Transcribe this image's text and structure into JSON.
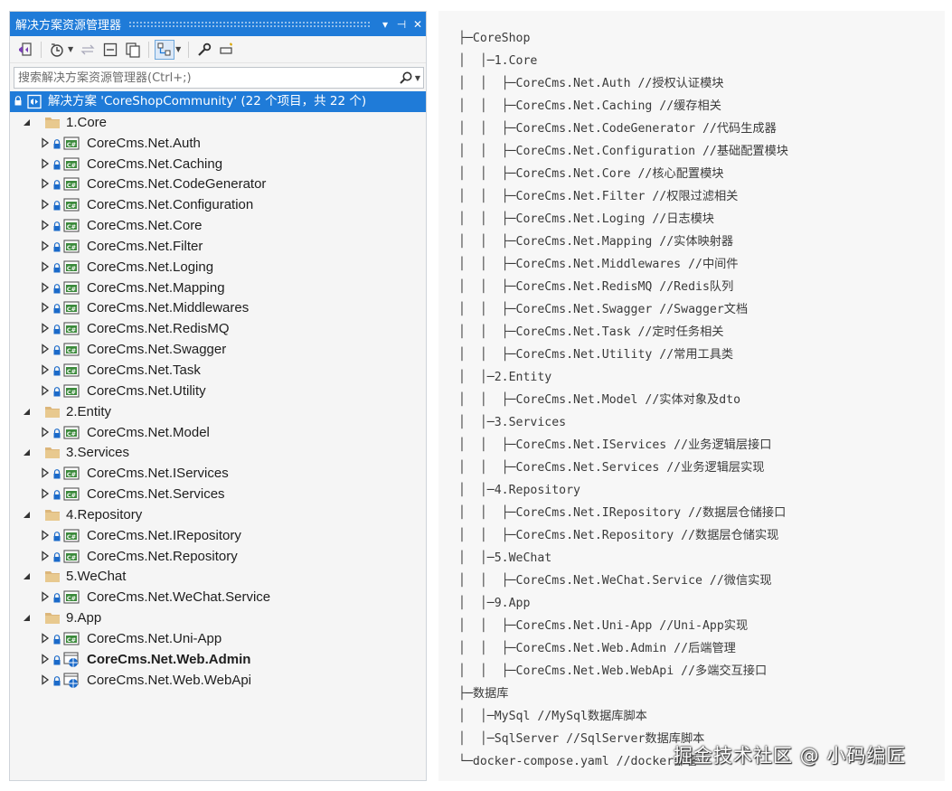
{
  "solution_explorer": {
    "title": "解决方案资源管理器",
    "controls": {
      "dropdown": "▾",
      "pin": "⊣",
      "close": "✕"
    },
    "search": {
      "placeholder": "搜索解决方案资源管理器(Ctrl+;)"
    },
    "colors": {
      "accent": "#1f7bd8",
      "folder": "#dcb67a",
      "project_icon": "#3c8a3c",
      "web_icon": "#1b6ac9"
    },
    "toolbar_icons": [
      "vs-switch-view-icon",
      "history-icon",
      "sync-icon",
      "collapse-all-icon",
      "show-all-files-icon",
      "git-changes-icon",
      "properties-wrench-icon",
      "preview-icon"
    ],
    "tree": [
      {
        "text": "解决方案 'CoreShopCommunity' (22 个项目，共 22 个)",
        "type": "solution",
        "level": 0,
        "selected": true
      },
      {
        "text": "1.Core",
        "type": "folder",
        "level": 1,
        "expanded": true
      },
      {
        "text": "CoreCms.Net.Auth",
        "type": "project",
        "level": 2
      },
      {
        "text": "CoreCms.Net.Caching",
        "type": "project",
        "level": 2
      },
      {
        "text": "CoreCms.Net.CodeGenerator",
        "type": "project",
        "level": 2
      },
      {
        "text": "CoreCms.Net.Configuration",
        "type": "project",
        "level": 2
      },
      {
        "text": "CoreCms.Net.Core",
        "type": "project",
        "level": 2
      },
      {
        "text": "CoreCms.Net.Filter",
        "type": "project",
        "level": 2
      },
      {
        "text": "CoreCms.Net.Loging",
        "type": "project",
        "level": 2
      },
      {
        "text": "CoreCms.Net.Mapping",
        "type": "project",
        "level": 2
      },
      {
        "text": "CoreCms.Net.Middlewares",
        "type": "project",
        "level": 2
      },
      {
        "text": "CoreCms.Net.RedisMQ",
        "type": "project",
        "level": 2
      },
      {
        "text": "CoreCms.Net.Swagger",
        "type": "project",
        "level": 2
      },
      {
        "text": "CoreCms.Net.Task",
        "type": "project",
        "level": 2
      },
      {
        "text": "CoreCms.Net.Utility",
        "type": "project",
        "level": 2
      },
      {
        "text": "2.Entity",
        "type": "folder",
        "level": 1,
        "expanded": true
      },
      {
        "text": "CoreCms.Net.Model",
        "type": "project",
        "level": 2
      },
      {
        "text": "3.Services",
        "type": "folder",
        "level": 1,
        "expanded": true
      },
      {
        "text": "CoreCms.Net.IServices",
        "type": "project",
        "level": 2
      },
      {
        "text": "CoreCms.Net.Services",
        "type": "project",
        "level": 2
      },
      {
        "text": "4.Repository",
        "type": "folder",
        "level": 1,
        "expanded": true
      },
      {
        "text": "CoreCms.Net.IRepository",
        "type": "project",
        "level": 2
      },
      {
        "text": "CoreCms.Net.Repository",
        "type": "project",
        "level": 2
      },
      {
        "text": "5.WeChat",
        "type": "folder",
        "level": 1,
        "expanded": true
      },
      {
        "text": "CoreCms.Net.WeChat.Service",
        "type": "project",
        "level": 2
      },
      {
        "text": "9.App",
        "type": "folder",
        "level": 1,
        "expanded": true
      },
      {
        "text": "CoreCms.Net.Uni-App",
        "type": "project",
        "level": 2
      },
      {
        "text": "CoreCms.Net.Web.Admin",
        "type": "web",
        "level": 2,
        "bold": true
      },
      {
        "text": "CoreCms.Net.Web.WebApi",
        "type": "web",
        "level": 2
      }
    ]
  },
  "directory_tree": [
    "├─CoreShop",
    "│  │─1.Core",
    "│  │  ├─CoreCms.Net.Auth //授权认证模块",
    "│  │  ├─CoreCms.Net.Caching //缓存相关",
    "│  │  ├─CoreCms.Net.CodeGenerator //代码生成器",
    "│  │  ├─CoreCms.Net.Configuration //基础配置模块",
    "│  │  ├─CoreCms.Net.Core //核心配置模块",
    "│  │  ├─CoreCms.Net.Filter //权限过滤相关",
    "│  │  ├─CoreCms.Net.Loging //日志模块",
    "│  │  ├─CoreCms.Net.Mapping //实体映射器",
    "│  │  ├─CoreCms.Net.Middlewares //中间件",
    "│  │  ├─CoreCms.Net.RedisMQ //Redis队列",
    "│  │  ├─CoreCms.Net.Swagger //Swagger文档",
    "│  │  ├─CoreCms.Net.Task //定时任务相关",
    "│  │  ├─CoreCms.Net.Utility //常用工具类",
    "│  │─2.Entity",
    "│  │  ├─CoreCms.Net.Model //实体对象及dto",
    "│  │─3.Services",
    "│  │  ├─CoreCms.Net.IServices //业务逻辑层接口",
    "│  │  ├─CoreCms.Net.Services //业务逻辑层实现",
    "│  │─4.Repository",
    "│  │  ├─CoreCms.Net.IRepository //数据层仓储接口",
    "│  │  ├─CoreCms.Net.Repository //数据层仓储实现",
    "│  │─5.WeChat",
    "│  │  ├─CoreCms.Net.WeChat.Service //微信实现",
    "│  │─9.App",
    "│  │  ├─CoreCms.Net.Uni-App //Uni-App实现",
    "│  │  ├─CoreCms.Net.Web.Admin //后端管理",
    "│  │  ├─CoreCms.Net.Web.WebApi //多端交互接口",
    "├─数据库",
    "│  │─MySql //MySql数据库脚本",
    "│  │─SqlServer //SqlServer数据库脚本",
    "└─docker-compose.yaml //docker部署"
  ],
  "watermark": "掘金技术社区 @ 小码编匠"
}
